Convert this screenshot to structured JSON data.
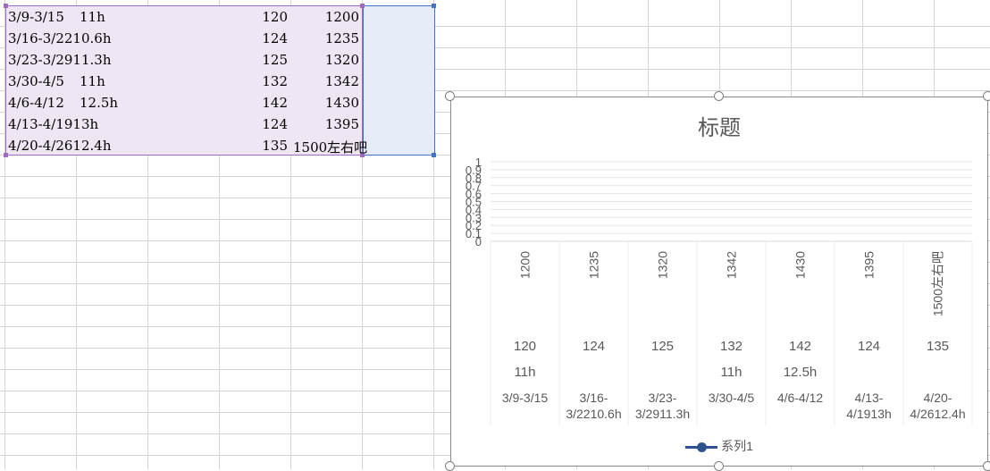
{
  "sheet": {
    "rows": [
      {
        "a": "3/9-3/15",
        "b": "11h",
        "d": "120",
        "e": "1200"
      },
      {
        "a": "3/16-3/2210.6h",
        "b": "",
        "d": "124",
        "e": "1235"
      },
      {
        "a": "3/23-3/2911.3h",
        "b": "",
        "d": "125",
        "e": "1320"
      },
      {
        "a": "3/30-4/5",
        "b": "11h",
        "d": "132",
        "e": "1342"
      },
      {
        "a": "4/6-4/12",
        "b": "12.5h",
        "d": "142",
        "e": "1430"
      },
      {
        "a": "4/13-4/1913h",
        "b": "",
        "d": "124",
        "e": "1395"
      },
      {
        "a": "4/20-4/2612.4h",
        "b": "",
        "d": "135",
        "e": "1500左右吧"
      }
    ]
  },
  "chart": {
    "title": "标题",
    "legend_label": "系列1",
    "series_color": "#2f528f",
    "y_ticks": [
      "0",
      "0.1",
      "0.2",
      "0.3",
      "0.4",
      "0.5",
      "0.6",
      "0.7",
      "0.8",
      "0.9",
      "1"
    ]
  },
  "chart_data": {
    "type": "line",
    "title": "标题",
    "ylim": [
      0,
      1
    ],
    "grid": true,
    "legend": "bottom",
    "series": [
      {
        "name": "系列1",
        "values": []
      }
    ],
    "categories": [
      {
        "top": "1200",
        "mid": "120",
        "low": "11h",
        "bottom": [
          "3/9-3/15"
        ]
      },
      {
        "top": "1235",
        "mid": "124",
        "low": "",
        "bottom": [
          "3/16-",
          "3/2210.6h"
        ]
      },
      {
        "top": "1320",
        "mid": "125",
        "low": "",
        "bottom": [
          "3/23-",
          "3/2911.3h"
        ]
      },
      {
        "top": "1342",
        "mid": "132",
        "low": "11h",
        "bottom": [
          "3/30-4/5"
        ]
      },
      {
        "top": "1430",
        "mid": "142",
        "low": "12.5h",
        "bottom": [
          "4/6-4/12"
        ]
      },
      {
        "top": "1395",
        "mid": "124",
        "low": "",
        "bottom": [
          "4/13-",
          "4/1913h"
        ]
      },
      {
        "top": "1500左右吧",
        "mid": "135",
        "low": "",
        "bottom": [
          "4/20-",
          "4/2612.4h"
        ]
      }
    ]
  }
}
